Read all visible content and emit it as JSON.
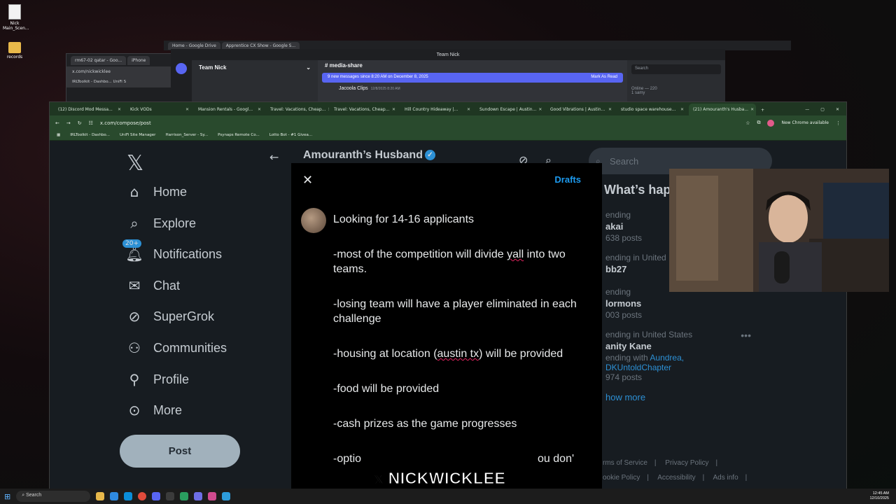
{
  "desktop": {
    "icons": [
      {
        "label": "Nick Main_Scen..."
      },
      {
        "label": "records"
      }
    ]
  },
  "bg_window_1": {
    "tabs": [
      "rm67-02 qatar - Goo...",
      "iPhone"
    ],
    "url": "x.com/nickwicklee",
    "bookmarks": [
      "IRLToolkit - Dashbo...",
      "UniFi S"
    ]
  },
  "bg_window_2": {
    "tabs": [
      "Home - Google Drive",
      "Apprentice CX Show - Google S..."
    ]
  },
  "discord": {
    "title": "Team Nick",
    "server_name": "Team Nick",
    "channel": "media-share",
    "banner": "9 new messages since 8:20 AM on December 8, 2025",
    "mark_read": "Mark As Read",
    "message_author": "Jacoola Clips",
    "message_time": "12/8/2025 8:20 AM",
    "search_placeholder": "Search",
    "online": "Online — 220",
    "online_user": "1 samy",
    "chrome_notice": "New Chrome available"
  },
  "chrome": {
    "tabs": [
      {
        "label": "(12) Discord Mod Messa..."
      },
      {
        "label": "Kick VODs"
      },
      {
        "label": "Mansion Rentals - Googl..."
      },
      {
        "label": "Travel: Vacations, Cheap..."
      },
      {
        "label": "Travel: Vacations, Cheap..."
      },
      {
        "label": "Hill Country Hideaway |..."
      },
      {
        "label": "Sundown Escape | Austin..."
      },
      {
        "label": "Good Vibrations | Austin..."
      },
      {
        "label": "studio space warehouse..."
      },
      {
        "label": "(21) Amouranth's Husba..."
      }
    ],
    "url": "x.com/compose/post",
    "chrome_notice": "New Chrome available",
    "bookmarks": [
      "IRLToolkit - Dashbo...",
      "UniFi Site Manager",
      "Harrison_Server - Sy...",
      "Psynaps Remote Co...",
      "Lotto Bot - #1 Givea..."
    ]
  },
  "x": {
    "nav": [
      {
        "label": "Home",
        "icon": "home-icon"
      },
      {
        "label": "Explore",
        "icon": "search-icon"
      },
      {
        "label": "Notifications",
        "icon": "bell-icon",
        "badge": "20+"
      },
      {
        "label": "Chat",
        "icon": "mail-icon"
      },
      {
        "label": "SuperGrok",
        "icon": "grok-icon"
      },
      {
        "label": "Communities",
        "icon": "communities-icon"
      },
      {
        "label": "Profile",
        "icon": "person-icon"
      },
      {
        "label": "More",
        "icon": "more-circle-icon"
      }
    ],
    "post_button": "Post",
    "feed_title": "Amouranth’s Husband",
    "search_placeholder": "Search",
    "whats_happening": "What’s hap",
    "trends": [
      {
        "context": "ending",
        "name": "akai",
        "posts": "638 posts"
      },
      {
        "context": "ending in United",
        "name": "bb27",
        "posts": ""
      },
      {
        "context": "ending",
        "name": "lormons",
        "posts": "003 posts"
      },
      {
        "context": "ending in United States",
        "name": "anity Kane",
        "trending_with_label": "ending with",
        "trending_with": "Aundrea,",
        "link2": "DKUntoldChapter",
        "posts": "974 posts"
      }
    ],
    "show_more": "how more",
    "footer": [
      "rms of Service",
      "Privacy Policy",
      "ookie Policy",
      "Accessibility",
      "Ads info"
    ]
  },
  "compose": {
    "drafts": "Drafts",
    "lines": [
      "Looking for 14-16 applicants",
      "-most of the competition will divide yall into two teams.",
      "-losing team will have a player eliminated in each challenge",
      "-housing at location (austin tx) will be provided",
      "-food will be provided",
      "-cash prizes as the game progresses",
      "-optio"
    ],
    "last_line_tail": "ou don'"
  },
  "watermark": "NICKWICKLEE",
  "taskbar": {
    "search_placeholder": "Search",
    "time": "12:45 AM",
    "date": "12/10/2025"
  }
}
